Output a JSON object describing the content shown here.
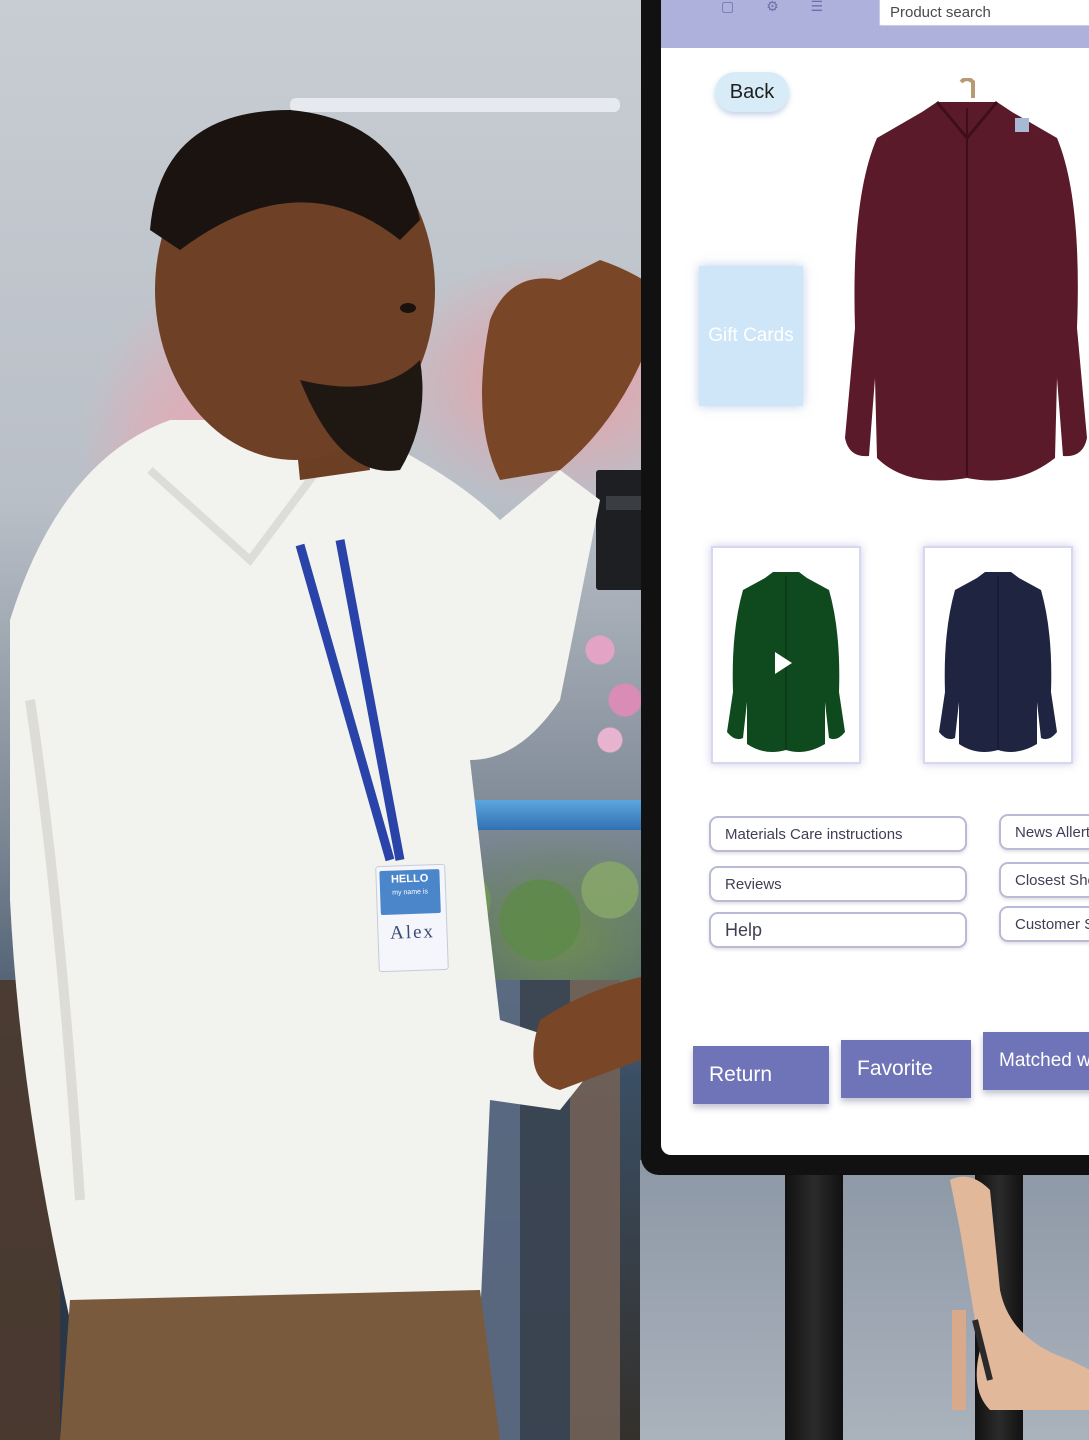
{
  "kiosk": {
    "search_placeholder": "Product search",
    "back_label": "Back",
    "gift_cards_label": "Gift Cards",
    "info_buttons_left": [
      "Materials  Care instructions",
      "Reviews",
      "Help"
    ],
    "info_buttons_right": [
      "News Allert",
      "Closest Shop",
      "Customer S"
    ],
    "actions": [
      "Return",
      "Favorite",
      "Matched wi"
    ],
    "product_colors": [
      "burgundy",
      "green",
      "navy"
    ],
    "top_icons": "▢ ⚙ ☰"
  },
  "badge": {
    "hello": "HELLO",
    "sub": "my name is",
    "name": "Alex"
  },
  "colors": {
    "top_bar": "#aeb1dc",
    "action_button": "#6f73b7",
    "gift_card": "#cfe6f8",
    "burgundy_shirt": "#5a1a2a",
    "green_shirt": "#0f4a1f",
    "navy_shirt": "#1f2440"
  }
}
